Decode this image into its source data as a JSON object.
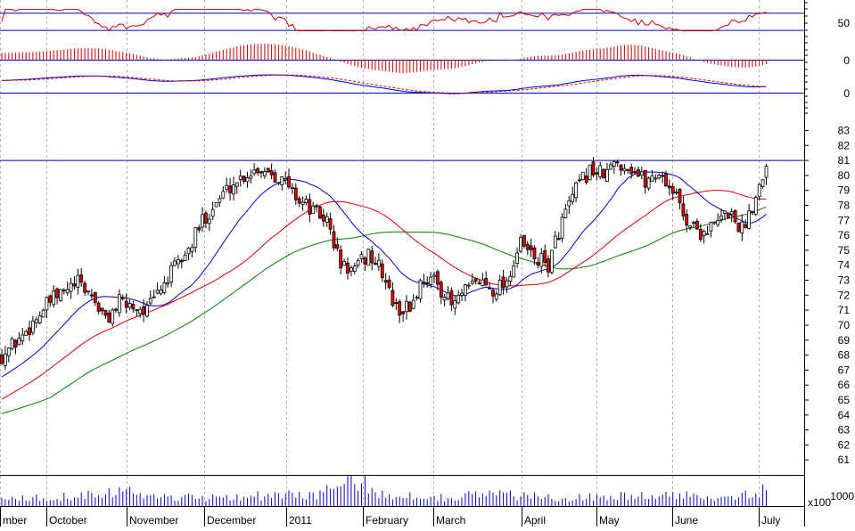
{
  "chart_data": {
    "type": "candlestick",
    "months": [
      "mber",
      "October",
      "November",
      "December",
      "2011",
      "February",
      "March",
      "April",
      "May",
      "June",
      "July"
    ],
    "price_axis": {
      "ticks": [
        61,
        62,
        63,
        64,
        65,
        66,
        67,
        68,
        69,
        70,
        71,
        72,
        73,
        74,
        75,
        76,
        77,
        78,
        79,
        80,
        81,
        82,
        83
      ],
      "range": [
        60,
        84.1
      ],
      "reference_level": 81
    },
    "rsi_axis": {
      "tick_labels": [
        "50"
      ],
      "levels": [
        70,
        30
      ],
      "range": [
        0,
        100
      ]
    },
    "histogram_axis": {
      "tick_labels": [
        "0"
      ]
    },
    "macd_axis": {
      "tick_labels": [
        "0"
      ]
    },
    "volume_axis": {
      "tick_labels": [
        "1000",
        "x100"
      ]
    },
    "colors": {
      "up": "#ffffff",
      "down": "#e00000",
      "ma_short": "#0000cc",
      "ma_mid": "#dd0000",
      "ma_long": "#008000",
      "grid": "#b8b8b8",
      "rsi": "#cc0000",
      "ref_line": "#0000aa"
    },
    "price_waypoints": [
      [
        0,
        68.0
      ],
      [
        6,
        69.3
      ],
      [
        10,
        70.5
      ],
      [
        14,
        71.6
      ],
      [
        18,
        72.2
      ],
      [
        22,
        72.8
      ],
      [
        26,
        72.0
      ],
      [
        30,
        70.3
      ],
      [
        34,
        71.5
      ],
      [
        38,
        71.3
      ],
      [
        42,
        71.0
      ],
      [
        46,
        72.5
      ],
      [
        50,
        73.8
      ],
      [
        54,
        75.0
      ],
      [
        58,
        77.0
      ],
      [
        62,
        78.2
      ],
      [
        66,
        79.3
      ],
      [
        70,
        80.0
      ],
      [
        74,
        80.5
      ],
      [
        78,
        80.3
      ],
      [
        82,
        79.5
      ],
      [
        86,
        78.4
      ],
      [
        90,
        77.6
      ],
      [
        94,
        77.0
      ],
      [
        98,
        74.0
      ],
      [
        102,
        73.6
      ],
      [
        106,
        74.8
      ],
      [
        110,
        73.5
      ],
      [
        114,
        71.0
      ],
      [
        118,
        71.2
      ],
      [
        122,
        73.2
      ],
      [
        126,
        72.8
      ],
      [
        130,
        71.3
      ],
      [
        134,
        72.2
      ],
      [
        138,
        73.0
      ],
      [
        142,
        72.4
      ],
      [
        146,
        73.0
      ],
      [
        150,
        75.4
      ],
      [
        154,
        74.5
      ],
      [
        158,
        74.0
      ],
      [
        162,
        77.0
      ],
      [
        166,
        79.0
      ],
      [
        170,
        80.4
      ],
      [
        174,
        80.0
      ],
      [
        178,
        80.9
      ],
      [
        182,
        80.5
      ],
      [
        186,
        79.6
      ],
      [
        190,
        80.2
      ],
      [
        194,
        79.0
      ],
      [
        198,
        77.0
      ],
      [
        202,
        76.2
      ],
      [
        206,
        76.6
      ],
      [
        210,
        77.6
      ],
      [
        214,
        76.4
      ],
      [
        218,
        78.6
      ],
      [
        221,
        81.0
      ]
    ],
    "volume_waypoints": [
      [
        0,
        0.25
      ],
      [
        20,
        0.35
      ],
      [
        30,
        0.55
      ],
      [
        50,
        0.3
      ],
      [
        70,
        0.35
      ],
      [
        90,
        0.4
      ],
      [
        104,
        0.85
      ],
      [
        110,
        0.4
      ],
      [
        130,
        0.3
      ],
      [
        140,
        0.45
      ],
      [
        150,
        0.35
      ],
      [
        165,
        0.3
      ],
      [
        185,
        0.35
      ],
      [
        200,
        0.35
      ],
      [
        215,
        0.4
      ],
      [
        221,
        0.55
      ]
    ]
  }
}
